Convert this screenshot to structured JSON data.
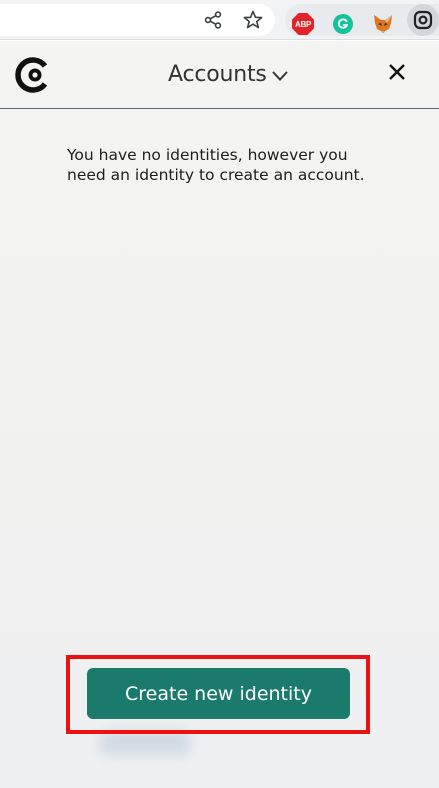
{
  "browser": {
    "toolbar_icons": [
      "share-icon",
      "bookmark-star-icon"
    ],
    "extensions": [
      {
        "name": "adblock-plus-extension-icon",
        "label": "ABP",
        "color": "#e0262b"
      },
      {
        "name": "grammarly-extension-icon",
        "label": "G",
        "color": "#15c39a"
      },
      {
        "name": "metamask-extension-icon",
        "color": "#e2761b"
      },
      {
        "name": "concordium-extension-icon",
        "active": true
      }
    ]
  },
  "popup": {
    "header": {
      "title": "Accounts",
      "logo": "concordium-logo",
      "close_icon": "close-icon"
    },
    "message": "You have no identities, however you need an identity to create an account.",
    "create_button_label": "Create new identity",
    "colors": {
      "button": "#1a7a6b",
      "highlight": "#ee1111",
      "header_border": "#4a6a75"
    }
  }
}
